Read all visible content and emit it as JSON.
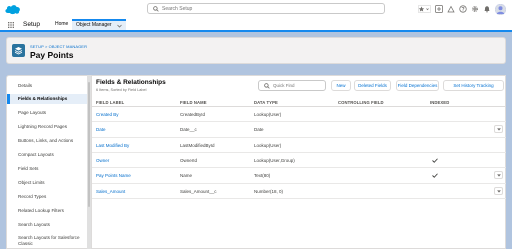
{
  "header": {
    "search_placeholder": "Search Setup"
  },
  "context": {
    "app_name": "Setup",
    "tabs": [
      {
        "label": "Home"
      },
      {
        "label": "Object Manager"
      }
    ]
  },
  "page": {
    "breadcrumb": "SETUP > OBJECT MANAGER",
    "title": "Pay Points"
  },
  "sidebar": {
    "items": [
      {
        "label": "Details"
      },
      {
        "label": "Fields & Relationships"
      },
      {
        "label": "Page Layouts"
      },
      {
        "label": "Lightning Record Pages"
      },
      {
        "label": "Buttons, Links, and Actions"
      },
      {
        "label": "Compact Layouts"
      },
      {
        "label": "Field Sets"
      },
      {
        "label": "Object Limits"
      },
      {
        "label": "Record Types"
      },
      {
        "label": "Related Lookup Filters"
      },
      {
        "label": "Search Layouts"
      },
      {
        "label": "Search Layouts for Salesforce"
      },
      {
        "label": "Classic"
      }
    ]
  },
  "main": {
    "title": "Fields & Relationships",
    "subtitle": "6 Items, Sorted by Field Label",
    "quick_find_placeholder": "Quick Find",
    "buttons": {
      "new": "New",
      "deleted": "Deleted Fields",
      "deps": "Field Dependencies",
      "track": "Set History Tracking"
    },
    "columns": [
      "FIELD LABEL",
      "FIELD NAME",
      "DATA TYPE",
      "CONTROLLING FIELD",
      "INDEXED"
    ],
    "rows": [
      {
        "label": "Created By",
        "name": "CreatedById",
        "type": "Lookup(User)",
        "controlling": "",
        "indexed": false
      },
      {
        "label": "Date",
        "name": "Date__c",
        "type": "Date",
        "controlling": "",
        "indexed": false
      },
      {
        "label": "Last Modified By",
        "name": "LastModifiedById",
        "type": "Lookup(User)",
        "controlling": "",
        "indexed": false
      },
      {
        "label": "Owner",
        "name": "OwnerId",
        "type": "Lookup(User,Group)",
        "controlling": "",
        "indexed": true
      },
      {
        "label": "Pay Points Name",
        "name": "Name",
        "type": "Text(80)",
        "controlling": "",
        "indexed": true
      },
      {
        "label": "Sales_Amount",
        "name": "Sales_Amount__c",
        "type": "Number(18, 0)",
        "controlling": "",
        "indexed": false
      }
    ]
  },
  "colors": {
    "brand": "#1589ee",
    "link": "#006dcc",
    "object_icon": "#2a739e",
    "background": "#b0c4df"
  }
}
